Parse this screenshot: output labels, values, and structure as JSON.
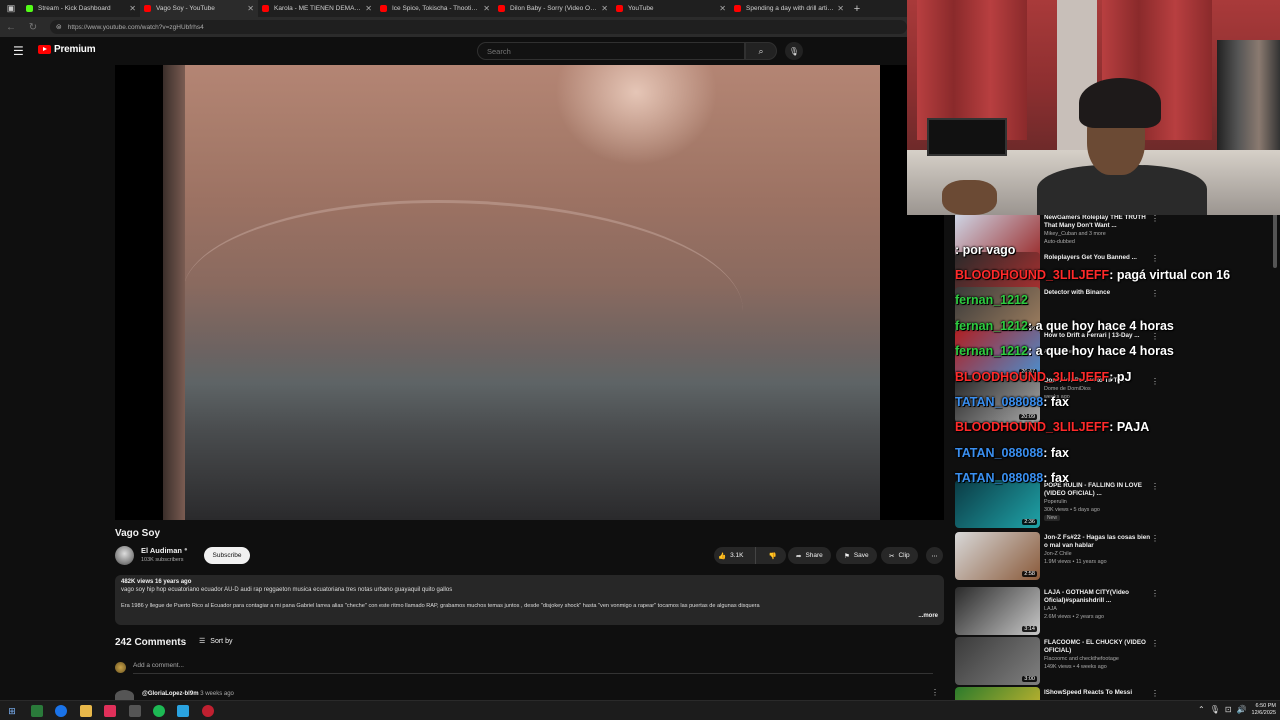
{
  "browser": {
    "tabs": [
      {
        "title": "Stream - Kick Dashboard",
        "favicon_color": "#53fc18"
      },
      {
        "title": "Vago Soy - YouTube",
        "favicon_color": "#ff0000"
      },
      {
        "title": "Karola - ME TIENEN DEMA (Video",
        "favicon_color": "#ff0000"
      },
      {
        "title": "Ice Spice, Tokischa - Thootie - Yo",
        "favicon_color": "#ff0000"
      },
      {
        "title": "Dilon Baby - Sorry (Video Oficial)",
        "favicon_color": "#ff0000"
      },
      {
        "title": "YouTube",
        "favicon_color": "#ff0000"
      },
      {
        "title": "Spending a day with drill artists in",
        "favicon_color": "#ff0000"
      }
    ],
    "url": "https://www.youtube.com/watch?v=zgHUbfrhs4"
  },
  "masthead": {
    "logo_text": "Premium",
    "search_placeholder": "Search"
  },
  "video": {
    "title": "Vago Soy",
    "channel": "El Audiman",
    "subscribers": "103K subscribers",
    "subscribe_label": "Subscribe",
    "likes": "3.1K",
    "share_label": "Share",
    "save_label": "Save",
    "clip_label": "Clip"
  },
  "description": {
    "meta": "482K views  16 years ago",
    "line1": "vago soy hip hop ecuatoriano ecuador AU-D audi rap reggaeton musica ecuatoriana tres notas urbano guayaquil quito gallos",
    "line2": "Era 1986 y llegue de Puerto Rico al Ecuador para  contagiar a mi pana Gabriel larrea alias \"cheche\" con este ritmo llamado RAP, grabamos muchos temas juntos , desde \"disjokey shock\"  hasta  \"ven vonmigo a rapear\"  tocamos las puertas de algunas disquera",
    "more_label": "...more"
  },
  "comments": {
    "count_label": "242 Comments",
    "sort_label": "Sort by",
    "add_placeholder": "Add a comment...",
    "first_author": "@GloriaLopez-bl9m",
    "first_time": "3 weeks ago"
  },
  "recommendations": [
    {
      "title": "NewGamers Roleplay THE TRUTH That Many Don't Want ...",
      "channel": "Mikey_Cuban and 3 more",
      "views": "Auto-dubbed",
      "duration": "",
      "thumb_colors": [
        "#cfd8e8",
        "#9a2b2b"
      ]
    },
    {
      "title": "Roleplayers Get You Banned ...",
      "channel": "",
      "views": "",
      "duration": "18:08",
      "thumb_colors": [
        "#2a2a2a",
        "#b03030"
      ]
    },
    {
      "title": "Detector with Binance",
      "channel": "",
      "views": "",
      "duration": "3:39",
      "thumb_colors": [
        "#3a3a3a",
        "#a08060"
      ]
    },
    {
      "title": "How to Drift a Ferrari | 13-Day ...",
      "channel": "",
      "views": "Auto-dubbed",
      "duration": "26:47",
      "thumb_colors": [
        "#b01f22",
        "#4a90d0"
      ]
    },
    {
      "title": "Dominios Reacts to TikTok",
      "channel": "Dome de DomiDios",
      "views": "weeks ago",
      "duration": "20:09",
      "thumb_colors": [
        "#262626",
        "#aaaaaa"
      ]
    },
    {
      "title": "POPE RULIN - FALLING IN LOVE (VIDEO OFICIAL) ...",
      "channel": "Poperulin",
      "views": "30K views • 5 days ago",
      "badge": "New",
      "duration": "2:36",
      "thumb_colors": [
        "#0b3b45",
        "#1fa3a8"
      ]
    },
    {
      "title": "Jon-Z Fs#22 - Hagas las cosas bien o mal van hablar",
      "channel": "Jon-Z Chile",
      "views": "1.9M views • 11 years ago",
      "duration": "2:58",
      "thumb_colors": [
        "#d8d8d8",
        "#8a5a3a"
      ]
    },
    {
      "title": "LAJA - GOTHAM CITY(Video Oficial)#spanishdrill ...",
      "channel": "LAJA",
      "views": "2.6M views • 2 years ago",
      "duration": "3:14",
      "thumb_colors": [
        "#2a2a2a",
        "#c8c8c8"
      ]
    },
    {
      "title": "FLACOOMC - EL CHUCKY (VIDEO OFICIAL)",
      "channel": "Flacoomc and checkthefootage",
      "views": "149K views • 4 weeks ago",
      "duration": "3:00",
      "thumb_colors": [
        "#3a3a3a",
        "#808080"
      ]
    },
    {
      "title": "IShowSpeed Reacts To Messi",
      "channel": "",
      "views": "",
      "duration": "",
      "thumb_colors": [
        "#2b7a2b",
        "#e0c030"
      ]
    }
  ],
  "chat": [
    {
      "user": "",
      "message": ": por vago",
      "user_color": "#ff3b3b"
    },
    {
      "user": "BLOODHOUND_3LILJEFF",
      "message": ": pagá virtual con 16",
      "user_color": "#ff2a2a"
    },
    {
      "user": "fernan_1212",
      "message": "",
      "user_color": "#2ecc40"
    },
    {
      "user": "fernan_1212",
      "message": ": a que hoy hace 4 horas",
      "user_color": "#2ecc40"
    },
    {
      "user": "fernan_1212",
      "message": ": a que hoy hace 4 horas",
      "user_color": "#2ecc40"
    },
    {
      "user": "BLOODHOUND_3LILJEFF",
      "message": ": pJ",
      "user_color": "#ff2a2a"
    },
    {
      "user": "TATAN_088088",
      "message": ": fax",
      "user_color": "#3a8ff0"
    },
    {
      "user": "BLOODHOUND_3LILJEFF",
      "message": ": PAJA",
      "user_color": "#ff2a2a"
    },
    {
      "user": "TATAN_088088",
      "message": ": fax",
      "user_color": "#3a8ff0"
    },
    {
      "user": "TATAN_088088",
      "message": ": fax",
      "user_color": "#3a8ff0"
    }
  ],
  "taskbar": {
    "time": "6:50 PM",
    "date": "12/6/2025"
  }
}
